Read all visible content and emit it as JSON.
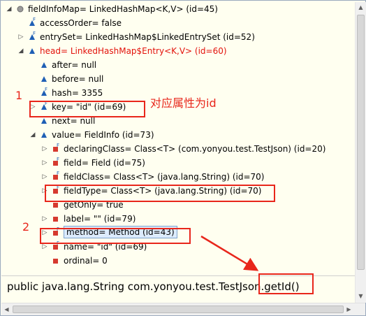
{
  "tree": {
    "rows": [
      {
        "label": "fieldInfoMap= LinkedHashMap<K,V>  (id=45)",
        "icon": "field-circle-icon",
        "expander": "expanded"
      },
      {
        "label": "accessOrder= false",
        "icon": "final-field-triangle-icon",
        "expander": "none"
      },
      {
        "label": "entrySet= LinkedHashMap$LinkedEntrySet  (id=52)",
        "icon": "final-field-triangle-icon",
        "expander": "collapsed"
      },
      {
        "label": "head= LinkedHashMap$Entry<K,V>  (id=60)",
        "icon": "field-triangle-icon",
        "expander": "expanded",
        "red": true
      },
      {
        "label": "after= null",
        "icon": "field-triangle-icon",
        "expander": "none"
      },
      {
        "label": "before= null",
        "icon": "field-triangle-icon",
        "expander": "none"
      },
      {
        "label": "hash= 3355",
        "icon": "final-field-triangle-icon",
        "expander": "none"
      },
      {
        "label": "key= \"id\" (id=69)",
        "icon": "final-field-triangle-icon",
        "expander": "collapsed"
      },
      {
        "label": "next= null",
        "icon": "field-triangle-icon",
        "expander": "none"
      },
      {
        "label": "value= FieldInfo  (id=73)",
        "icon": "field-triangle-icon",
        "expander": "expanded"
      },
      {
        "label": "declaringClass= Class<T> (com.yonyou.test.TestJson) (id=20)",
        "icon": "final-field-square-icon",
        "expander": "collapsed"
      },
      {
        "label": "field= Field  (id=75)",
        "icon": "final-field-square-icon",
        "expander": "collapsed"
      },
      {
        "label": "fieldClass= Class<T> (java.lang.String) (id=70)",
        "icon": "final-field-square-icon",
        "expander": "collapsed"
      },
      {
        "label": "fieldType= Class<T> (java.lang.String) (id=70)",
        "icon": "final-field-square-icon",
        "expander": "collapsed"
      },
      {
        "label": "getOnly= true",
        "icon": "field-square-icon",
        "expander": "none"
      },
      {
        "label": "label= \"\" (id=79)",
        "icon": "field-square-icon",
        "expander": "collapsed"
      },
      {
        "label": "method= Method  (id=43)",
        "icon": "final-field-square-icon",
        "expander": "collapsed",
        "selected": true
      },
      {
        "label": "name= \"id\" (id=69)",
        "icon": "final-field-square-icon",
        "expander": "collapsed"
      },
      {
        "label": "ordinal= 0",
        "icon": "field-square-icon",
        "expander": "none"
      }
    ]
  },
  "detail": {
    "text": "public java.lang.String com.yonyou.test.TestJson.getId()"
  },
  "annotations": {
    "number_1": "1",
    "number_2": "2",
    "note": "对应属性为id"
  },
  "colors": {
    "annotation_red": "#e8261b",
    "panel_bg": "#fffff0",
    "icon_blue": "#1f5fb5",
    "icon_red": "#d63a2f",
    "selection": "#dcebfc"
  }
}
